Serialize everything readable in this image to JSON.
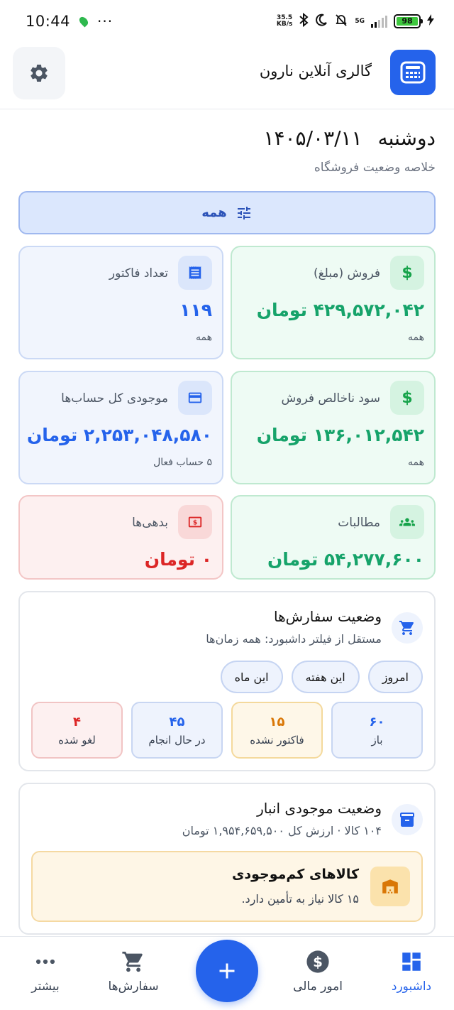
{
  "status_bar": {
    "time": "10:44",
    "more": "···",
    "speed_top": "35.5",
    "speed_unit": "KB/s",
    "network": "5G",
    "battery": "98"
  },
  "header": {
    "title": "گالری آنلاین نارون"
  },
  "date": {
    "weekday": "دوشنبه",
    "value": "۱۴۰۵/۰۳/۱۱",
    "subtitle": "خلاصه وضعیت فروشگاه"
  },
  "filter": {
    "label": "همه"
  },
  "cards": {
    "sales": {
      "label": "فروش (مبلغ)",
      "value": "۴۲۹,۵۷۲,۰۴۲ تومان",
      "note": "همه"
    },
    "invoices": {
      "label": "تعداد فاکتور",
      "value": "۱۱۹",
      "note": "همه"
    },
    "gross_profit": {
      "label": "سود ناخالص فروش",
      "value": "۱۳۶,۰۱۲,۵۴۲ تومان",
      "note": "همه"
    },
    "accounts": {
      "label": "موجودی کل حساب‌ها",
      "value": "۲,۲۵۳,۰۴۸,۵۸۰ تومان",
      "note": "۵ حساب فعال"
    },
    "receivables": {
      "label": "مطالبات",
      "value": "۵۴,۲۷۷,۶۰۰ تومان"
    },
    "debts": {
      "label": "بدهی‌ها",
      "value": "۰ تومان"
    }
  },
  "orders": {
    "title": "وضعیت سفارش‌ها",
    "subtitle": "مستقل از فیلتر داشبورد: همه زمان‌ها",
    "chips": [
      "امروز",
      "این هفته",
      "این ماه"
    ],
    "tiles": [
      {
        "num": "۶۰",
        "label": "باز"
      },
      {
        "num": "۱۵",
        "label": "فاکتور نشده"
      },
      {
        "num": "۴۵",
        "label": "در حال انجام"
      },
      {
        "num": "۴",
        "label": "لغو شده"
      }
    ]
  },
  "inventory": {
    "title": "وضعیت موجودی انبار",
    "subtitle": "۱۰۴ کالا · ارزش کل ۱,۹۵۴,۶۵۹,۵۰۰ تومان",
    "low_stock_title": "کالاهای کم‌موجودی",
    "low_stock_text": "۱۵ کالا نیاز به تأمین دارد."
  },
  "nav": {
    "dashboard": "داشبورد",
    "finance": "امور مالی",
    "orders": "سفارش‌ها",
    "more": "بیشتر"
  },
  "colors": {
    "primary": "#2563eb",
    "success": "#16a36a",
    "danger": "#dc2626",
    "warning": "#d97706"
  }
}
